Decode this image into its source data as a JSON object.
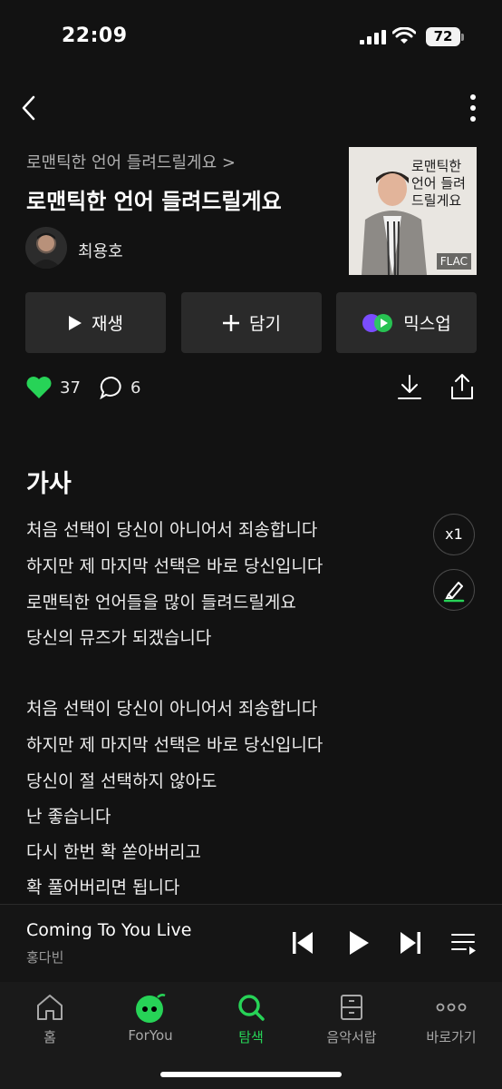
{
  "status": {
    "time": "22:09",
    "battery": "72"
  },
  "header": {
    "breadcrumb": "로맨틱한 언어 들려드릴게요 >",
    "title": "로맨틱한 언어 들려드릴게요",
    "artist": "최용호",
    "album_text": "로맨틱한 언어 들려드릴게요",
    "quality_badge": "FLAC"
  },
  "actions": {
    "play": "재생",
    "add": "담기",
    "mixup": "믹스업"
  },
  "stats": {
    "likes": "37",
    "comments": "6"
  },
  "lyrics": {
    "title": "가사",
    "speed": "x1",
    "lines": [
      "처음 선택이 당신이 아니어서 죄송합니다",
      "하지만 제 마지막 선택은 바로 당신입니다",
      "로맨틱한 언어들을 많이 들려드릴게요",
      "당신의 뮤즈가 되겠습니다",
      "처음 선택이 당신이 아니어서 죄송합니다",
      "하지만 제 마지막 선택은 바로 당신입니다",
      "당신이 절 선택하지 않아도",
      "난 좋습니다",
      "다시 한번 확 쏟아버리고",
      "확 풀어버리면 됩니다"
    ]
  },
  "now_playing": {
    "title": "Coming To You Live",
    "artist": "홍다빈"
  },
  "nav": [
    {
      "label": "홈",
      "icon": "home-icon"
    },
    {
      "label": "ForYou",
      "icon": "foryou-icon"
    },
    {
      "label": "탐색",
      "icon": "search-icon"
    },
    {
      "label": "음악서랍",
      "icon": "drawer-icon"
    },
    {
      "label": "바로가기",
      "icon": "more-horizontal-icon"
    }
  ],
  "colors": {
    "accent": "#27d357",
    "background": "#121212",
    "button": "#2a2a2a"
  }
}
